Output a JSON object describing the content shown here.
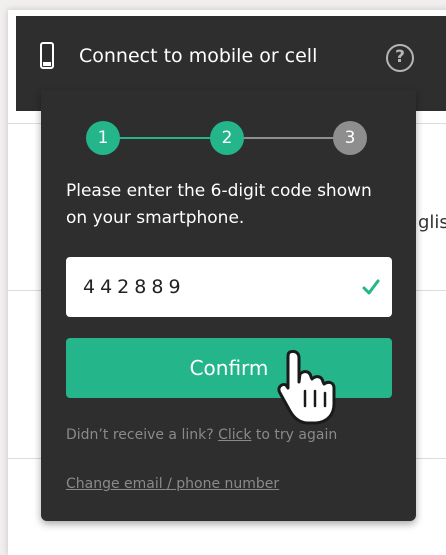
{
  "header": {
    "title": "Connect to mobile or cell",
    "phone_icon": "mobile-phone-icon",
    "help_icon": "question-circle-icon",
    "help_glyph": "?"
  },
  "background": {
    "partial_text": "glis"
  },
  "steps": [
    {
      "label": "1",
      "state": "complete"
    },
    {
      "label": "2",
      "state": "current"
    },
    {
      "label": "3",
      "state": "pending"
    }
  ],
  "instructions": "Please enter the 6-digit code shown on your smartphone.",
  "code_input": {
    "value": "442889",
    "valid_icon": "checkmark-icon"
  },
  "confirm_label": "Confirm",
  "resend": {
    "prefix": "Didn’t receive a link? ",
    "link": "Click",
    "suffix": " to try again"
  },
  "change_link": "Change email / phone number",
  "colors": {
    "accent": "#24b58a",
    "panel": "#2e2e2e",
    "step_pending": "#8e8e8e",
    "muted_text": "#8a8a8a"
  }
}
